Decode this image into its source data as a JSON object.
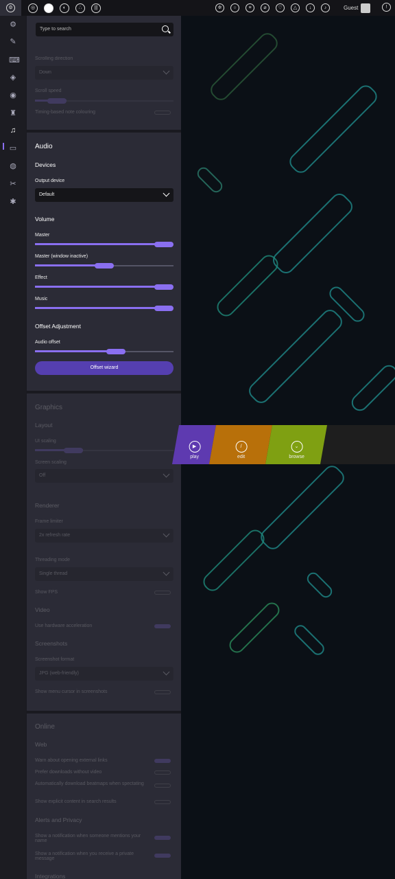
{
  "toolbar": {
    "user_name": "Guest"
  },
  "colors": {
    "accent": "#8a6ff0",
    "button": "#553fb0",
    "panel": "#2b2b36",
    "play": "#5e3ab0",
    "edit": "#b8700a",
    "browse": "#7fa012"
  },
  "search": {
    "placeholder": "Type to search"
  },
  "gameplay": {
    "scroll_direction_label": "Scrolling direction",
    "scroll_direction_value": "Down",
    "scroll_speed_label": "Scroll speed",
    "timing_colouring_label": "Timing-based note colouring"
  },
  "audio": {
    "title": "Audio",
    "devices_title": "Devices",
    "output_device_label": "Output device",
    "output_device_value": "Default",
    "volume_title": "Volume",
    "master_label": "Master",
    "master_inactive_label": "Master (window inactive)",
    "effect_label": "Effect",
    "music_label": "Music",
    "offset_title": "Offset Adjustment",
    "audio_offset_label": "Audio offset",
    "offset_wizard_label": "Offset wizard",
    "levels": {
      "master": 1.0,
      "master_inactive": 0.5,
      "effect": 1.0,
      "music": 1.0,
      "audio_offset": 0.6
    }
  },
  "graphics": {
    "title": "Graphics",
    "layout_title": "Layout",
    "ui_scaling_label": "UI scaling",
    "screen_scaling_label": "Screen scaling",
    "screen_scaling_value": "Off",
    "renderer_title": "Renderer",
    "frame_limiter_label": "Frame limiter",
    "frame_limiter_value": "2x refresh rate",
    "threading_label": "Threading mode",
    "threading_value": "Single thread",
    "show_fps_label": "Show FPS",
    "video_title": "Video",
    "hw_accel_label": "Use hardware acceleration",
    "screenshots_title": "Screenshots",
    "screenshot_format_label": "Screenshot format",
    "screenshot_format_value": "JPG (web-friendly)",
    "menu_cursor_label": "Show menu cursor in screenshots"
  },
  "online": {
    "title": "Online",
    "web_title": "Web",
    "warn_links_label": "Warn about opening external links",
    "prefer_no_video_label": "Prefer downloads without video",
    "auto_download_label": "Automatically download beatmaps when spectating",
    "explicit_label": "Show explicit content in search results",
    "alerts_title": "Alerts and Privacy",
    "notify_mention_label": "Show a notification when someone mentions your name",
    "notify_pm_label": "Show a notification when you receive a private message",
    "integrations_title": "Integrations"
  },
  "main_menu": {
    "play_label": "play",
    "edit_label": "edit",
    "browse_label": "browse"
  }
}
